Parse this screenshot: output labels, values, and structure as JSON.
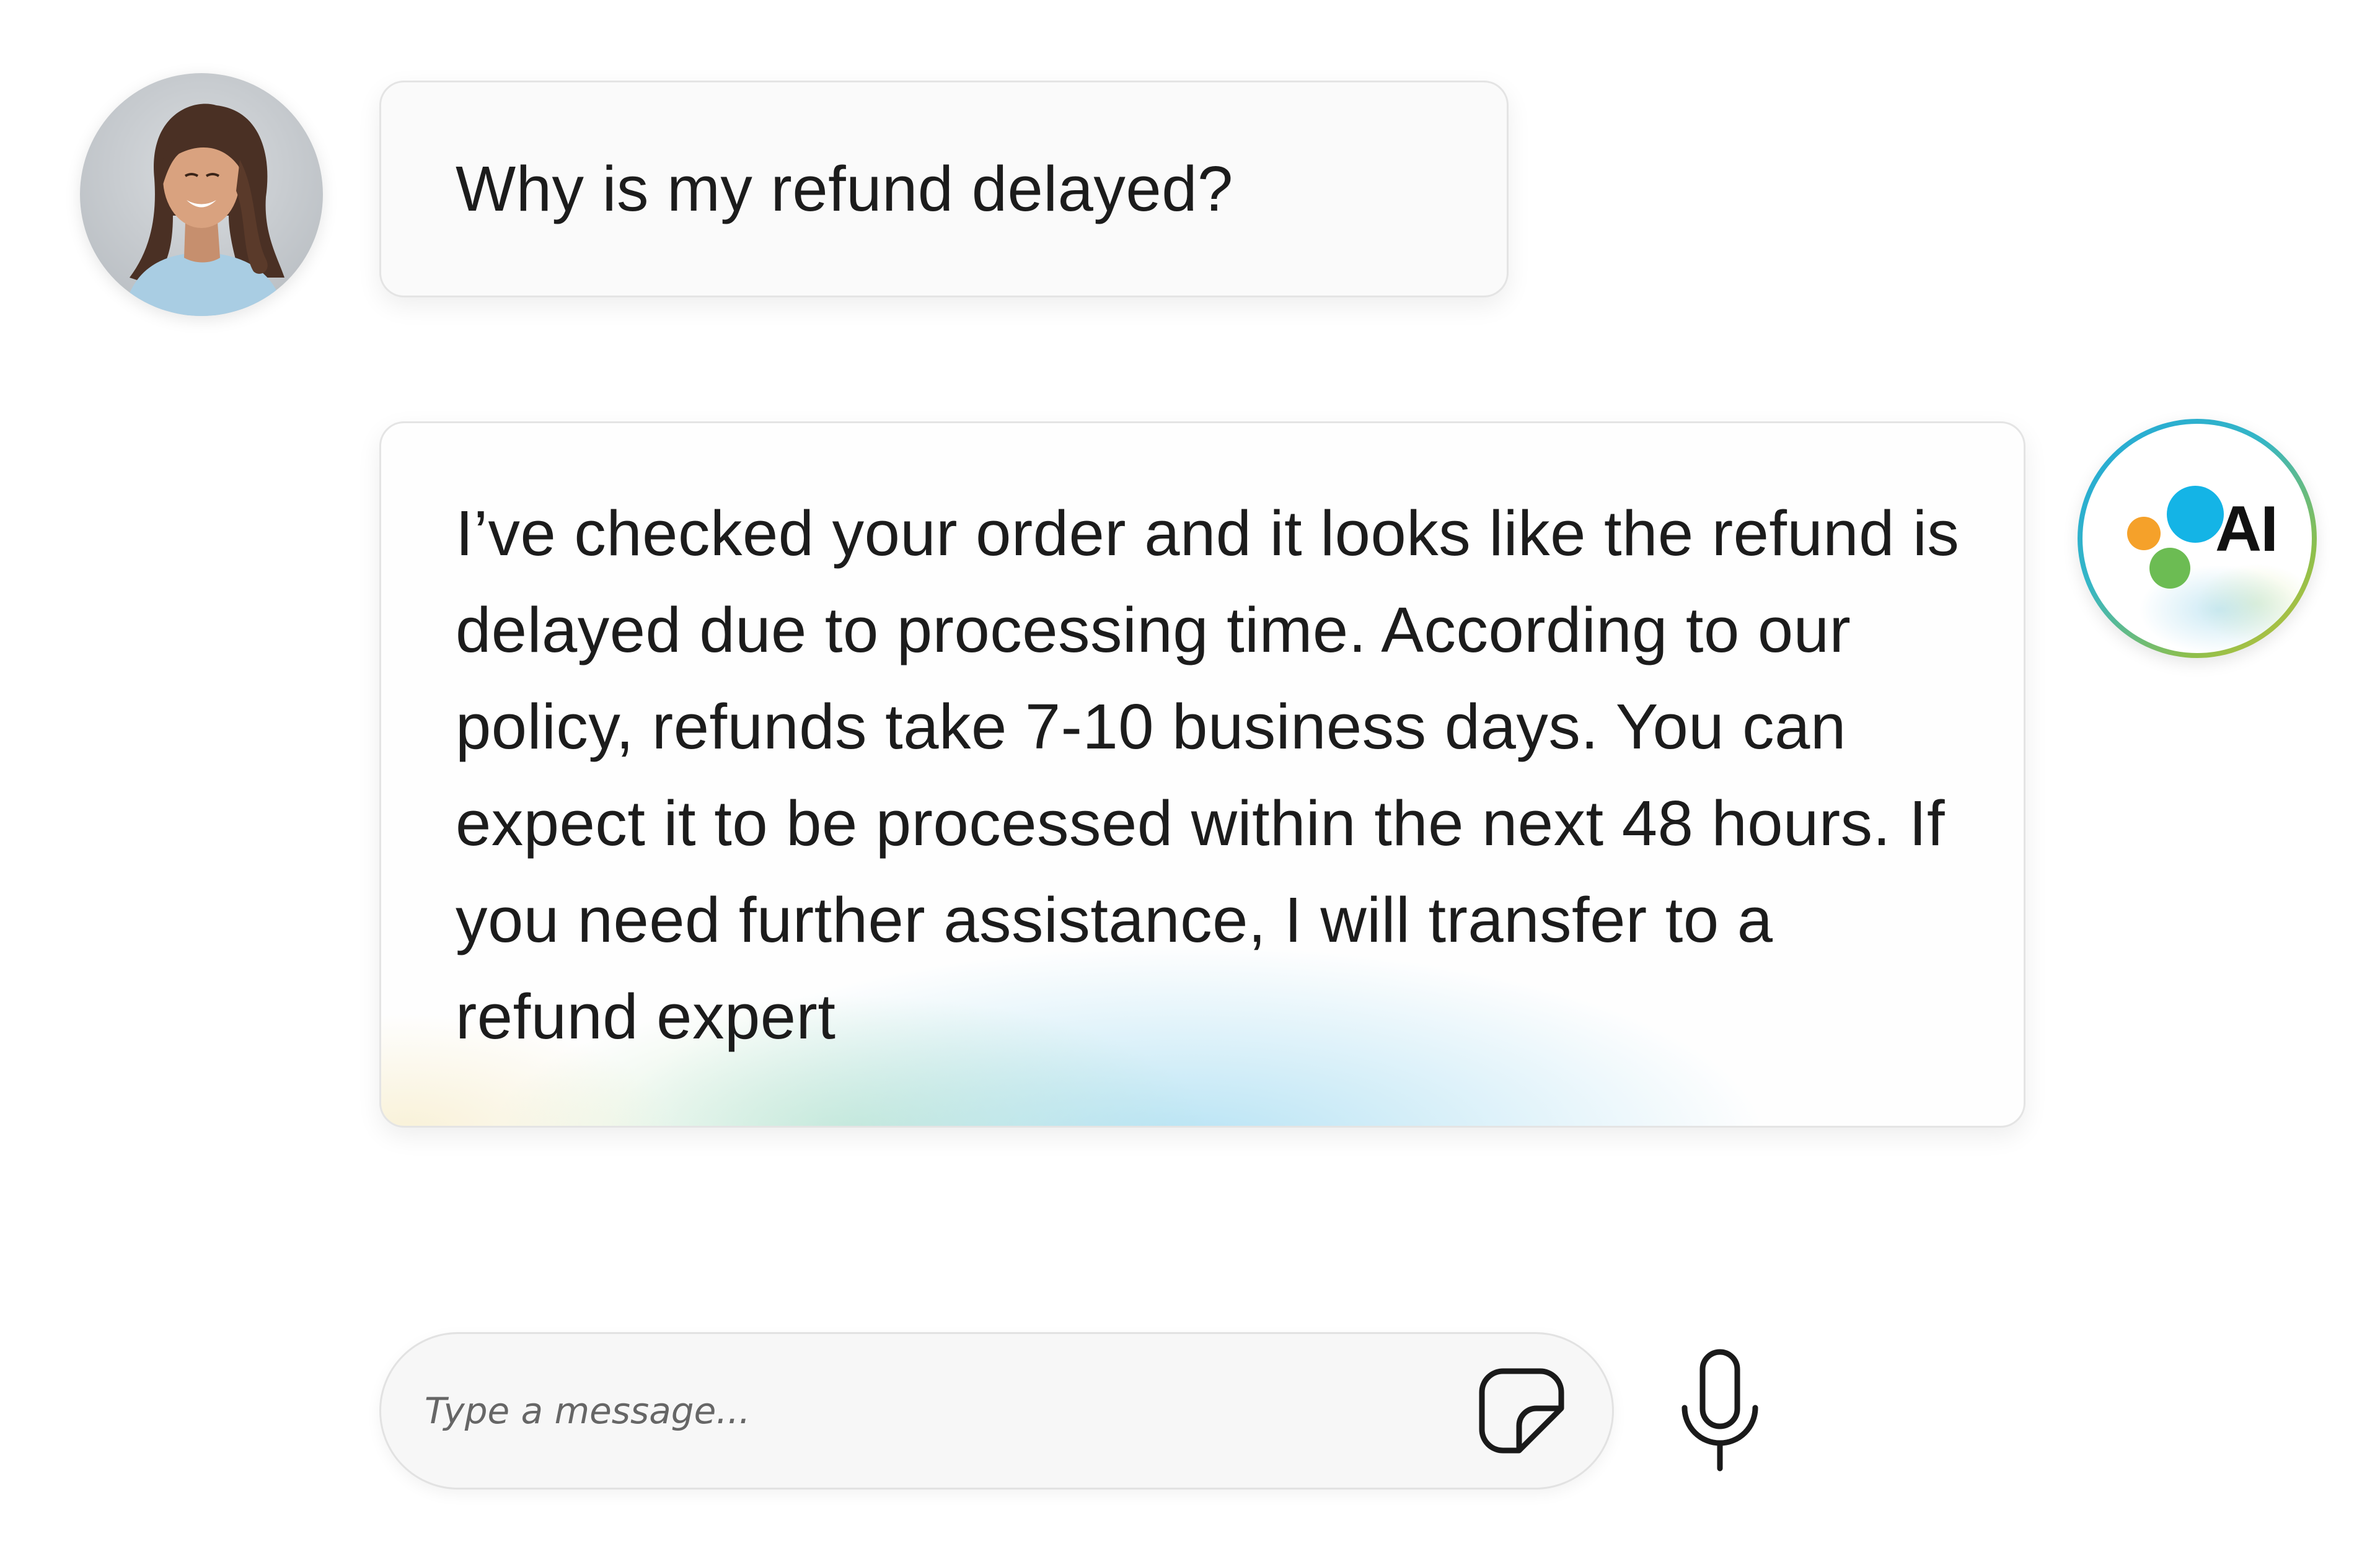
{
  "conversation": {
    "user_message": {
      "avatar": "user-photo",
      "text": "Why is my refund delayed?"
    },
    "ai_message": {
      "avatar_label": "AI",
      "avatar_dot_colors": [
        "#f5a12a",
        "#14b4e6",
        "#6cbc53"
      ],
      "text": "I’ve checked your order and it looks like the refund is delayed due to processing time. According to our policy, refunds take 7-10 business days. You can expect it to be processed within the next 48 hours. If you need further assistance, I will transfer to a refund expert"
    }
  },
  "composer": {
    "placeholder": "Type a message...",
    "value": "",
    "sticker_icon": "sticker-icon",
    "mic_icon": "microphone-icon"
  }
}
